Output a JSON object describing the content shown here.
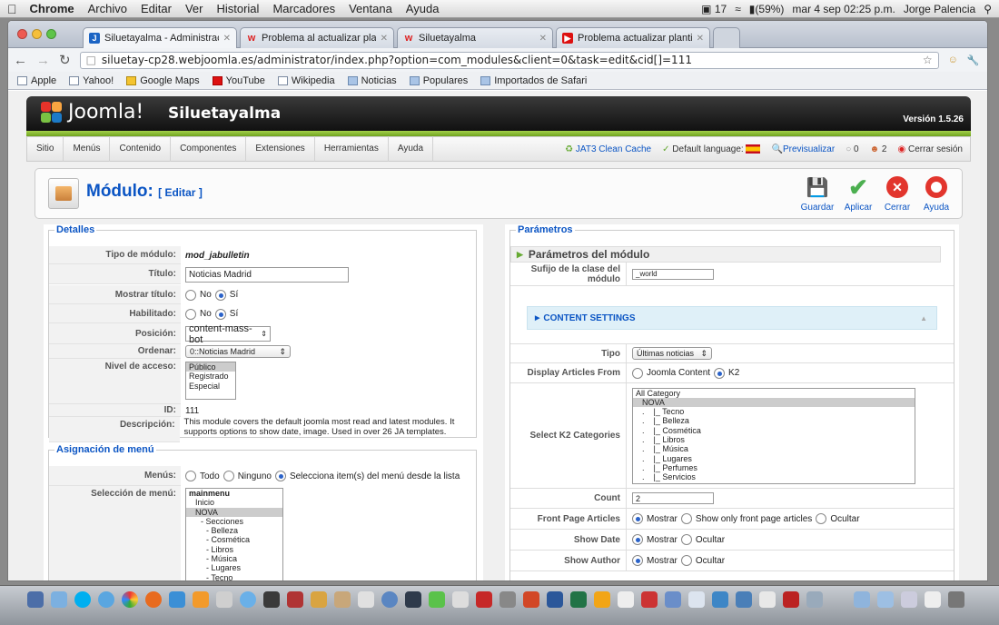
{
  "macbar": {
    "app": "Chrome",
    "menus": [
      "Archivo",
      "Editar",
      "Ver",
      "Historial",
      "Marcadores",
      "Ventana",
      "Ayuda"
    ],
    "badge": "17",
    "battery": "(59%)",
    "datetime": "mar 4 sep  02:25 p.m.",
    "user": "Jorge Palencia"
  },
  "browser": {
    "tabs": [
      {
        "title": "Siluetayalma - Administració",
        "fav": "J",
        "color": "#1b64c4"
      },
      {
        "title": "Problema al actualizar plantil",
        "fav": "w",
        "color": "#d22"
      },
      {
        "title": "Siluetayalma",
        "fav": "w",
        "color": "#d22"
      },
      {
        "title": "Problema actualizar plantilla",
        "fav": "▶",
        "color": "#d11"
      }
    ],
    "url": "siluetay-cp28.webjoomla.es/administrator/index.php?option=com_modules&client=0&task=edit&cid[]=111",
    "bookmarks": [
      "Apple",
      "Yahoo!",
      "Google Maps",
      "YouTube",
      "Wikipedia",
      "Noticias",
      "Populares",
      "Importados de Safari"
    ]
  },
  "joomla": {
    "logo": "Joomla!",
    "site": "Siluetayalma",
    "version": "Versión 1.5.26",
    "menu": [
      "Sitio",
      "Menús",
      "Contenido",
      "Componentes",
      "Extensiones",
      "Herramientas",
      "Ayuda"
    ],
    "status": {
      "cache": "JAT3 Clean Cache",
      "lang": "Default language:",
      "preview": "Previsualizar",
      "count1": "0",
      "count2": "2",
      "logout": "Cerrar sesión"
    },
    "title": "Módulo:",
    "title_sub": "[ Editar ]",
    "buttons": {
      "save": "Guardar",
      "apply": "Aplicar",
      "close": "Cerrar",
      "help": "Ayuda"
    }
  },
  "details": {
    "legend": "Detalles",
    "type_label": "Tipo de módulo:",
    "type_value": "mod_jabulletin",
    "title_label": "Título:",
    "title_value": "Noticias Madrid",
    "show_title_label": "Mostrar título:",
    "no": "No",
    "yes": "Sí",
    "enabled_label": "Habilitado:",
    "position_label": "Posición:",
    "position_value": "content-mass-bot",
    "order_label": "Ordenar:",
    "order_value": "0::Noticias Madrid",
    "access_label": "Nivel de acceso:",
    "access_options": [
      "Público",
      "Registrado",
      "Especial"
    ],
    "id_label": "ID:",
    "id_value": "111",
    "desc_label": "Descripción:",
    "desc_value": "This module covers the default joomla most read and latest modules. It supports options to show date, image. Used in over 26 JA templates."
  },
  "menu_assign": {
    "legend": "Asignación de menú",
    "menus_label": "Menús:",
    "opt_all": "Todo",
    "opt_none": "Ninguno",
    "opt_select": "Selecciona item(s) del menú desde la lista",
    "sel_label": "Selección de menú:",
    "items": [
      "mainmenu",
      "Inicio",
      "NOVA",
      "- Secciones",
      "- Belleza",
      "- Cosmética",
      "- Libros",
      "- Música",
      "- Lugares",
      "- Tecno"
    ]
  },
  "params": {
    "legend": "Parámetros",
    "module_params": "Parámetros del módulo",
    "suffix_label": "Sufijo de la clase del módulo",
    "suffix_value": "_world",
    "content_settings": "CONTENT SETTINGS",
    "tipo_label": "Tipo",
    "tipo_value": "Últimas noticias",
    "from_label": "Display Articles From",
    "from_joomla": "Joomla Content",
    "from_k2": "K2",
    "cats_label": "Select K2 Categories",
    "cats": [
      "All Category",
      "NOVA",
      ".    |_ Tecno",
      ".    |_ Belleza",
      ".    |_ Cosmética",
      ".    |_ Libros",
      ".    |_ Música",
      ".    |_ Lugares",
      ".    |_ Perfumes",
      ".    |_ Servicios"
    ],
    "count_label": "Count",
    "count_value": "2",
    "front_label": "Front Page Articles",
    "front_show": "Mostrar",
    "front_only": "Show only front page articles",
    "front_hide": "Ocultar",
    "date_label": "Show Date",
    "author_label": "Show Author",
    "show": "Mostrar",
    "hide": "Ocultar"
  }
}
